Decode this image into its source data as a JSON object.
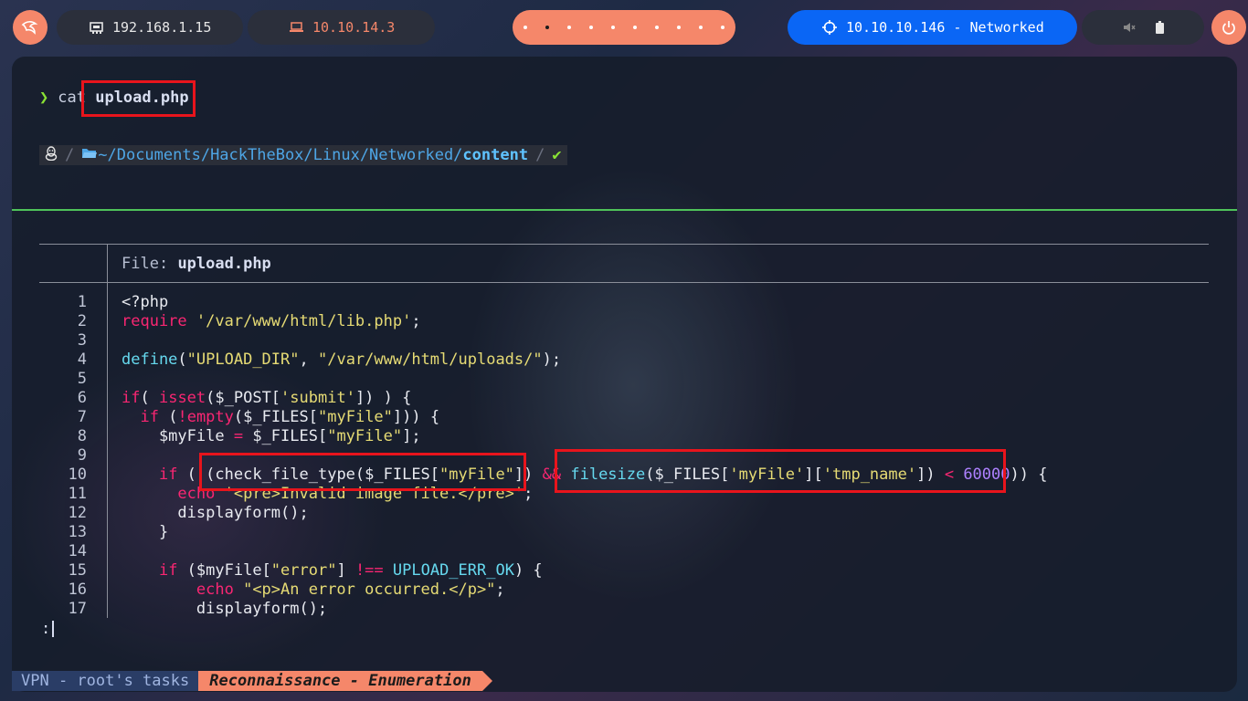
{
  "topbar": {
    "menu_icon": "kali-dragon-icon",
    "eth_ip": "192.168.1.15",
    "eth_icon": "network-card-icon",
    "vpn_ip": "10.10.14.3",
    "vpn_icon": "laptop-icon",
    "workspaces": [
      {
        "active": false
      },
      {
        "active": true
      },
      {
        "active": false
      },
      {
        "active": false
      },
      {
        "active": false
      },
      {
        "active": false
      },
      {
        "active": false
      },
      {
        "active": false
      },
      {
        "active": false
      },
      {
        "active": false
      }
    ],
    "target_label": "10.10.10.146 - Networked",
    "target_icon": "crosshair-icon",
    "mute_icon": "volume-mute-icon",
    "battery_icon": "battery-icon",
    "power_icon": "power-icon",
    "colors": {
      "accent": "#f5876a",
      "target": "#0a66f5",
      "pill": "#2b2f3b"
    }
  },
  "terminal": {
    "command": "cat",
    "argument": "upload.php",
    "prompt": {
      "os_icon": "linux-tux-icon",
      "folder_icon": "folder-open-icon",
      "path_dir": "~/Documents/HackTheBox/Linux/Networked/",
      "path_current": "content",
      "status": "✔"
    },
    "file_label": "File:",
    "file_name": "upload.php",
    "code": {
      "lines": [
        "1",
        "2",
        "3",
        "4",
        "5",
        "6",
        "7",
        "8",
        "9",
        "10",
        "11",
        "12",
        "13",
        "14",
        "15",
        "16",
        "17"
      ],
      "t1": "<?php",
      "require_kw": "require",
      "require_str": "'/var/www/html/lib.php'",
      "semicolon": ";",
      "define_fn": "define",
      "define_open": "(",
      "define_a1": "\"UPLOAD_DIR\"",
      "comma": ", ",
      "define_a2": "\"/var/www/html/uploads/\"",
      "define_close": ");",
      "if_kw": "if",
      "isset_open": "( ",
      "isset_fn": "isset",
      "isset_arg_pre": "($_POST[",
      "isset_arg_str": "'submit'",
      "isset_close": "]) ) {",
      "if2_indent": "  ",
      "if2_open": " (",
      "not_op": "!",
      "empty_fn": "empty",
      "empty_arg_pre": "($_FILES[",
      "empty_arg_str": "\"myFile\"",
      "empty_close": "])) {",
      "l8_pre": "    $myFile ",
      "eq_op": "=",
      "l8_post": " $_FILES[",
      "l8_str": "\"myFile\"",
      "l8_close": "];",
      "l10_indent": "    ",
      "l10_open": " ( ",
      "l10_cft": "(check_file_type($_FILES[",
      "l10_cft_str": "\"myFile\"",
      "l10_cft_close": "]) ",
      "and_op": "&&",
      "l10_fs_fn": " filesize",
      "l10_fs_pre": "($_FILES[",
      "l10_fs_s1": "'myFile'",
      "l10_fs_mid": "][",
      "l10_fs_s2": "'tmp_name'",
      "l10_fs_close": "]) ",
      "lt_op": "<",
      "l10_num": " 60000",
      "l10_end": ")) {",
      "l11_indent": "      ",
      "echo_kw": "echo",
      "l11_str": " '<pre>Invalid image file.</pre>'",
      "l11_end": ";",
      "l12": "      displayform();",
      "l13": "    }",
      "l15_indent": "    ",
      "l15_pre": " ($myFile[",
      "l15_str": "\"error\"",
      "l15_mid": "] ",
      "neq_op": "!==",
      "l15_const": " UPLOAD_ERR_OK",
      "l15_end": ") {",
      "l16_indent": "        ",
      "l16_str": " \"<p>An error occurred.</p>\"",
      "l16_end": ";",
      "l17": "        displayform();"
    },
    "pager_prompt": ":"
  },
  "statusbar": {
    "session": "VPN - root's tasks",
    "window": "Reconnaissance - Enumeration"
  }
}
